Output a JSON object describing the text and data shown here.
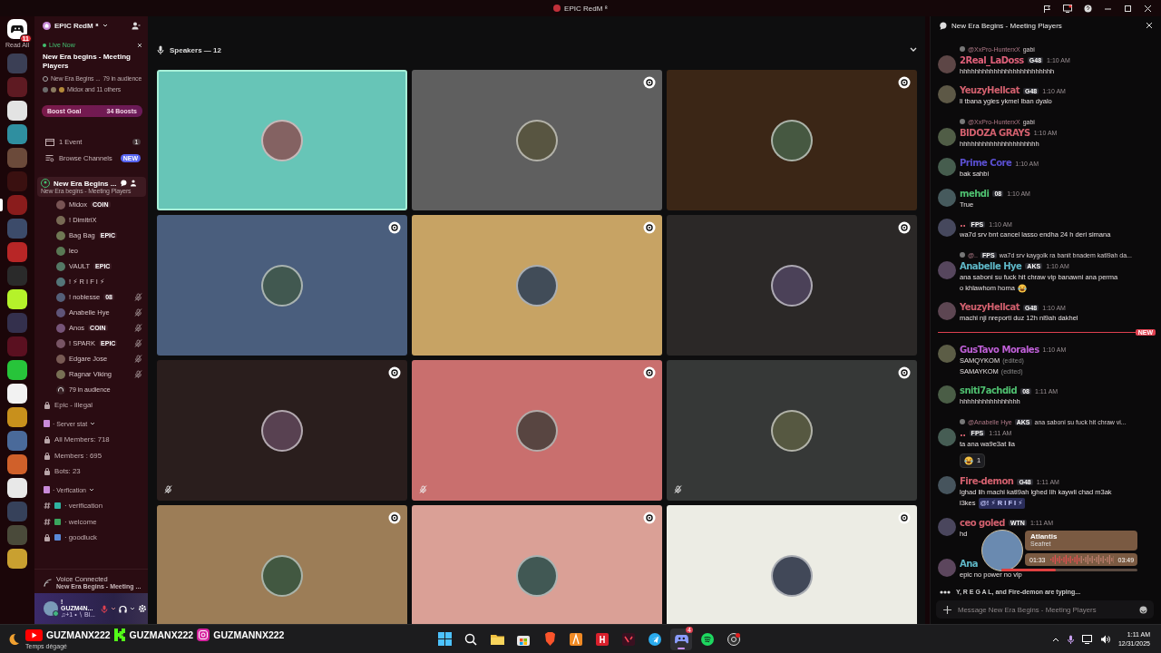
{
  "window": {
    "title": "EPIC RedM ⁸"
  },
  "server_rail": {
    "read_all": "Read All",
    "badge": "11",
    "servers": [
      {
        "color": "#3b3f55",
        "selected": false
      },
      {
        "color": "#5e1a22",
        "selected": false
      },
      {
        "color": "#e3e3e3",
        "selected": false
      },
      {
        "color": "#2f8fa0",
        "selected": false
      },
      {
        "color": "#6b4a3a",
        "selected": false
      },
      {
        "color": "#3a1010",
        "selected": false
      },
      {
        "color": "#8a1c1c",
        "selected": true
      },
      {
        "color": "#3c4b6a",
        "selected": false
      },
      {
        "color": "#b82626",
        "selected": false
      },
      {
        "color": "#2a2a2a",
        "selected": false
      },
      {
        "color": "#b5f22a",
        "selected": false
      },
      {
        "color": "#34304d",
        "selected": false
      },
      {
        "color": "#5a1020",
        "selected": false
      },
      {
        "color": "#27c43a",
        "selected": false
      },
      {
        "color": "#f2f2f2",
        "selected": false
      },
      {
        "color": "#c8901c",
        "selected": false
      },
      {
        "color": "#4a6a9a",
        "selected": false
      },
      {
        "color": "#d0602a",
        "selected": false
      },
      {
        "color": "#e8e8e8",
        "selected": false
      },
      {
        "color": "#36415a",
        "selected": false
      },
      {
        "color": "#4a4a3a",
        "selected": false
      },
      {
        "color": "#c9a030",
        "selected": false
      }
    ]
  },
  "sidebar": {
    "server_name": "EPIC RedM ⁸",
    "live": {
      "label": "Live Now",
      "title": "New Era begins - Meeting Players",
      "channel": "New Era Begins ...",
      "audience": "79 in audience",
      "listeners": "Midox and 11 others"
    },
    "boost": {
      "label": "Boost Goal",
      "count": "34 Boosts"
    },
    "event": {
      "label": "1 Event",
      "count": "1"
    },
    "browse": {
      "label": "Browse Channels",
      "badge": "NEW"
    },
    "voice_channel": {
      "name": "New Era Begins ...",
      "topic": "New Era begins - Meeting Players",
      "selected": true
    },
    "members": [
      {
        "name": "Midox",
        "tag": "COIN",
        "muted": false
      },
      {
        "name": "! DimitriX",
        "muted": false
      },
      {
        "name": "Bag Bag",
        "tag": "EPIC",
        "muted": false
      },
      {
        "name": "leo",
        "muted": false
      },
      {
        "name": "VAULT",
        "tag": "EPIC",
        "muted": false
      },
      {
        "name": "! ⚡ R I F I ⚡",
        "muted": false
      },
      {
        "name": "! noblesse",
        "tag": "08",
        "muted": true
      },
      {
        "name": "Anabelle Hye",
        "muted": true
      },
      {
        "name": "Anos",
        "tag": "COIN",
        "muted": true
      },
      {
        "name": "! SPARK",
        "tag": "EPIC",
        "muted": true
      },
      {
        "name": "Edgare Jose",
        "muted": true
      },
      {
        "name": "Ragnar Viking",
        "muted": true
      }
    ],
    "audience": "79 in audience",
    "channels": [
      {
        "kind": "locked",
        "name": "Epic - illegal"
      },
      {
        "kind": "category",
        "name": "· Server stat"
      },
      {
        "kind": "locked",
        "name": "All Members: 718"
      },
      {
        "kind": "locked",
        "name": "Members : 695"
      },
      {
        "kind": "locked",
        "name": "Bots: 23"
      },
      {
        "kind": "category",
        "name": "· Verfication"
      },
      {
        "kind": "text",
        "name": "· verification"
      },
      {
        "kind": "text",
        "name": "· welcome"
      },
      {
        "kind": "locked",
        "name": "· goodluck"
      }
    ],
    "voice_connected": {
      "status": "Voice Connected",
      "channel": "New Era Begins - Meeting ..."
    },
    "user": {
      "name": "! GUZM4N...",
      "status": "♫+1 • ∖ Bl..."
    }
  },
  "stage": {
    "header": "Speakers — 12",
    "tiles": [
      {
        "color": "#67c5b7",
        "speaking": true,
        "muted": false
      },
      {
        "color": "#5f5f5f",
        "speaking": false,
        "muted": false
      },
      {
        "color": "#3b2616",
        "speaking": false,
        "muted": false
      },
      {
        "color": "#4a5e7d",
        "speaking": false,
        "muted": false
      },
      {
        "color": "#c7a364",
        "speaking": false,
        "muted": false
      },
      {
        "color": "#2b2827",
        "speaking": false,
        "muted": false
      },
      {
        "color": "#2a1e1d",
        "speaking": false,
        "muted": true
      },
      {
        "color": "#c96f6e",
        "speaking": false,
        "muted": true
      },
      {
        "color": "#363837",
        "speaking": false,
        "muted": true
      },
      {
        "color": "#9c7d57",
        "speaking": false,
        "muted": false
      },
      {
        "color": "#daa096",
        "speaking": false,
        "muted": false
      },
      {
        "color": "#ecece4",
        "speaking": false,
        "muted": false
      }
    ]
  },
  "chat": {
    "title": "New Era Begins - Meeting Players",
    "messages": [
      {
        "kind": "message",
        "reply": {
          "author": "@XxPro-HunterxX",
          "text": "gabi"
        },
        "author": "2Real_LaDoss",
        "color": "#e0607a",
        "tag": "G48",
        "time": "1:10 AM",
        "lines": [
          {
            "text": "hhhhhhhhhhhhhhhhhhhhhhhhh"
          }
        ]
      },
      {
        "kind": "message",
        "author": "YeuzyHellcat",
        "color": "#d2606e",
        "tag": "G48",
        "time": "1:10 AM",
        "lines": [
          {
            "text": "li tbana ygles ykmel lban dyalo"
          }
        ]
      },
      {
        "kind": "message",
        "reply": {
          "author": "@XxPro-HunterxX",
          "text": "gabi"
        },
        "author": "BIDOZA GRAYS",
        "color": "#d2606e",
        "time": "1:10 AM",
        "lines": [
          {
            "text": "hhhhhhhhhhhhhhhhhhhhh"
          }
        ]
      },
      {
        "kind": "message",
        "author": "Prime Core",
        "color": "#5a4fd0",
        "time": "1:10 AM",
        "lines": [
          {
            "text": "bak sahbi"
          }
        ]
      },
      {
        "kind": "message",
        "author": "mehdi",
        "color": "#4fc070",
        "tag": "08",
        "time": "1:10 AM",
        "lines": [
          {
            "text": "True"
          }
        ]
      },
      {
        "kind": "message",
        "author": "..",
        "color": "#d2606e",
        "tag": "FPS",
        "time": "1:10 AM",
        "lines": [
          {
            "text": "wa7d srv bnt cancel lasso endha 24 h deri simana"
          }
        ]
      },
      {
        "kind": "message",
        "reply": {
          "author": "@..",
          "tag": "FPS",
          "text": "wa7d srv kaygolk ra banit bnadem katl9ah da..."
        },
        "author": "Anabelle Hye",
        "color": "#5fb8c8",
        "tag": "AKS",
        "time": "1:10 AM",
        "lines": [
          {
            "text": "ana saboni su fuck hit chraw vip banawni ana perma"
          },
          {
            "text": "o khlawhom homa",
            "emoji": true
          }
        ]
      },
      {
        "kind": "message",
        "author": "YeuzyHellcat",
        "color": "#d2606e",
        "tag": "G48",
        "time": "1:10 AM",
        "lines": [
          {
            "text": "machi nji nreporti duz 12h nl9ah dakhel"
          }
        ]
      },
      {
        "kind": "divider",
        "label": "NEW"
      },
      {
        "kind": "message",
        "author": "GusTavo Morales",
        "color": "#c060d8",
        "time": "1:10 AM",
        "lines": [
          {
            "text": "SAMQYKOM",
            "note": "(edited)"
          },
          {
            "text": "SAMAYKOM",
            "note": "(edited)"
          }
        ]
      },
      {
        "kind": "message",
        "author": "sniti7achdid",
        "color": "#4fc070",
        "tag": "08",
        "time": "1:11 AM",
        "lines": [
          {
            "text": "hhhhhhhhhhhhhhhh"
          }
        ]
      },
      {
        "kind": "message",
        "reply": {
          "author": "@Anabelle Hye",
          "tag": "AKS",
          "text": "ana saboni su fuck hit chraw vi..."
        },
        "author": "..",
        "color": "#d2606e",
        "tag": "FPS",
        "time": "1:11 AM",
        "lines": [
          {
            "text": "ta ana wa9e3at lia"
          }
        ],
        "reaction": {
          "count": "1"
        }
      },
      {
        "kind": "message",
        "author": "Fire-demon",
        "color": "#d2606e",
        "tag": "G48",
        "time": "1:11 AM",
        "lines": [
          {
            "text": "lghad lih machi katl9ah lghed lih kaywli chad m3ak"
          },
          {
            "text": "l3kes",
            "mention": "@! ⚡ R I F I ⚡"
          }
        ]
      },
      {
        "kind": "message",
        "author": "ceo goled",
        "color": "#d2606e",
        "tag": "WTN",
        "time": "1:11 AM",
        "lines": [
          {
            "text": "hd"
          }
        ]
      },
      {
        "kind": "message",
        "author": "Ana",
        "color": "#5fb8c8",
        "lines": [
          {
            "text": "epic no power no vip"
          }
        ]
      }
    ],
    "typing": "Y, R E G A L, and Fire-demon are typing...",
    "placeholder": "Message New Era Begins - Meeting Players",
    "now_playing": {
      "title": "Atlantis",
      "artist": "Seafret",
      "elapsed": "01:33",
      "duration": "03:49",
      "level": 0.4
    }
  },
  "taskbar": {
    "weather": "Temps dégagé",
    "socials": [
      {
        "kind": "youtube",
        "handle": "GUZMANX222"
      },
      {
        "kind": "kick",
        "handle": "GUZMANX222"
      },
      {
        "kind": "instagram",
        "handle": "GUZMANNX222"
      }
    ],
    "apps": [
      {
        "kind": "start",
        "selected": false
      },
      {
        "kind": "search",
        "selected": false
      },
      {
        "kind": "explorer",
        "selected": false
      },
      {
        "kind": "store",
        "selected": false
      },
      {
        "kind": "brave",
        "selected": false
      },
      {
        "kind": "orange-app",
        "selected": false
      },
      {
        "kind": "red-app",
        "selected": false
      },
      {
        "kind": "valorant",
        "selected": false
      },
      {
        "kind": "telegram",
        "selected": false
      },
      {
        "kind": "discord",
        "selected": true,
        "badge": "4"
      },
      {
        "kind": "spotify",
        "selected": false
      },
      {
        "kind": "obs",
        "selected": false
      }
    ],
    "time": "1:11 AM",
    "date": "12/31/2025"
  }
}
